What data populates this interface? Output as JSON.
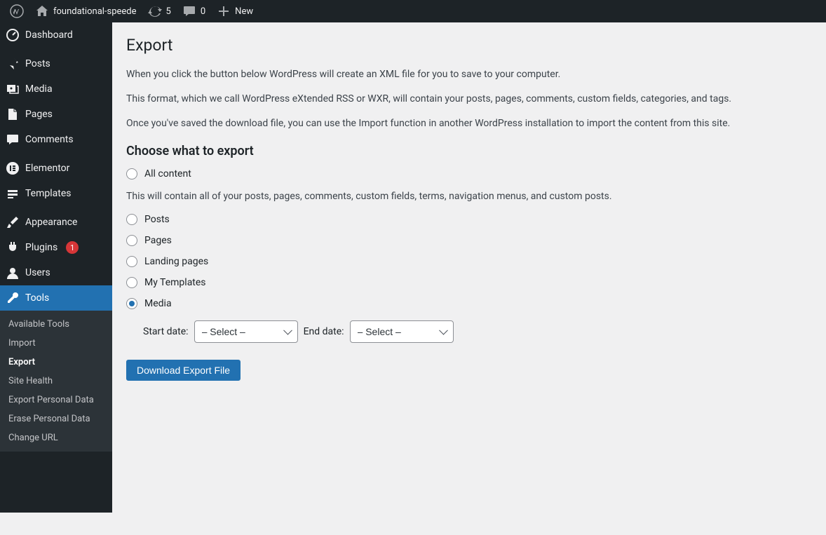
{
  "adminbar": {
    "site_name": "foundational-speede",
    "update_count": "5",
    "comment_count": "0",
    "new_label": "New"
  },
  "sidebar": {
    "items": [
      {
        "label": "Dashboard",
        "icon": "dashboard"
      },
      {
        "label": "Posts",
        "icon": "pin"
      },
      {
        "label": "Media",
        "icon": "media"
      },
      {
        "label": "Pages",
        "icon": "page"
      },
      {
        "label": "Comments",
        "icon": "comment"
      },
      {
        "label": "Elementor",
        "icon": "elementor"
      },
      {
        "label": "Templates",
        "icon": "templates"
      },
      {
        "label": "Appearance",
        "icon": "brush"
      },
      {
        "label": "Plugins",
        "icon": "plug",
        "badge": "1"
      },
      {
        "label": "Users",
        "icon": "user"
      },
      {
        "label": "Tools",
        "icon": "wrench",
        "current": true
      }
    ],
    "submenu": {
      "items": [
        {
          "label": "Available Tools"
        },
        {
          "label": "Import"
        },
        {
          "label": "Export",
          "current": true
        },
        {
          "label": "Site Health"
        },
        {
          "label": "Export Personal Data"
        },
        {
          "label": "Erase Personal Data"
        },
        {
          "label": "Change URL"
        }
      ]
    }
  },
  "main": {
    "title": "Export",
    "intro_1": "When you click the button below WordPress will create an XML file for you to save to your computer.",
    "intro_2": "This format, which we call WordPress eXtended RSS or WXR, will contain your posts, pages, comments, custom fields, categories, and tags.",
    "intro_3": "Once you've saved the download file, you can use the Import function in another WordPress installation to import the content from this site.",
    "section_heading": "Choose what to export",
    "all_content_label": "All content",
    "all_content_help": "This will contain all of your posts, pages, comments, custom fields, terms, navigation menus, and custom posts.",
    "options": [
      {
        "label": "Posts"
      },
      {
        "label": "Pages"
      },
      {
        "label": "Landing pages"
      },
      {
        "label": "My Templates"
      },
      {
        "label": "Media",
        "checked": true
      }
    ],
    "start_date_label": "Start date:",
    "end_date_label": "End date:",
    "select_placeholder": "– Select –",
    "download_button": "Download Export File"
  }
}
